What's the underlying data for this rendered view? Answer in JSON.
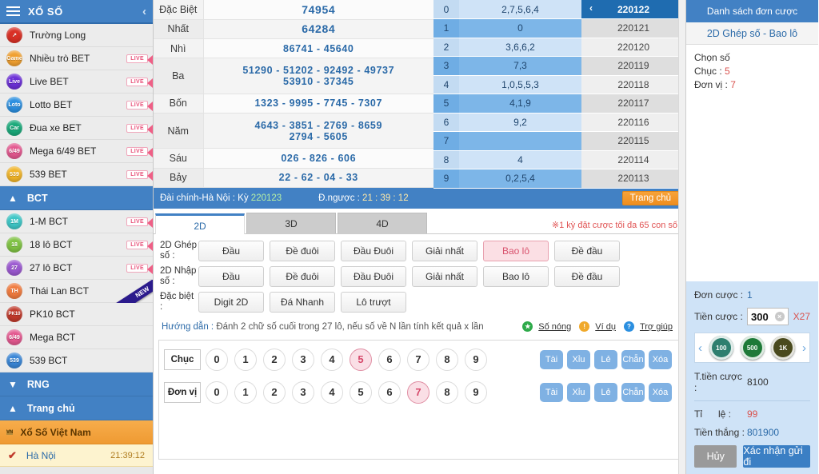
{
  "sidebar": {
    "header": {
      "title": "XỔ SỐ",
      "menu_icon": "hamburger-icon",
      "collapse_icon": "chevron-left-icon"
    },
    "items": [
      {
        "label": "Trường Long",
        "icon": "chart-icon",
        "icon_text": "",
        "color": "#d93025",
        "live": ""
      },
      {
        "label": "Nhiều trò BET",
        "icon": "game-icon",
        "icon_text": "Game",
        "color": "#f0a030",
        "live": "LIVE"
      },
      {
        "label": "Live BET",
        "icon": "live-icon",
        "icon_text": "Live",
        "color": "#6b2fd6",
        "live": "LIVE"
      },
      {
        "label": "Lotto BET",
        "icon": "lotto-icon",
        "icon_text": "Loto",
        "color": "#2b8fe0",
        "live": "LIVE"
      },
      {
        "label": "Đua xe BET",
        "icon": "car-icon",
        "icon_text": "Car",
        "color": "#1aa97a",
        "live": "LIVE"
      },
      {
        "label": "Mega 6/49 BET",
        "icon": "mega649-icon",
        "icon_text": "6/49",
        "color": "#e3588f",
        "live": "LIVE"
      },
      {
        "label": "539 BET",
        "icon": "539-icon",
        "icon_text": "539",
        "color": "#f0b429",
        "live": "LIVE"
      }
    ],
    "group_bct": {
      "label": "BCT",
      "arrow": "▲"
    },
    "bct_items": [
      {
        "label": "1-M BCT",
        "icon": "1m-bct-icon",
        "icon_text": "1M",
        "color": "#3ec6c6",
        "live": "LIVE",
        "new": ""
      },
      {
        "label": "18 lô BCT",
        "icon": "18-bct-icon",
        "icon_text": "18",
        "color": "#7fc243",
        "live": "LIVE",
        "new": ""
      },
      {
        "label": "27 lô BCT",
        "icon": "27-bct-icon",
        "icon_text": "27",
        "color": "#9b59d0",
        "live": "LIVE",
        "new": ""
      },
      {
        "label": "Thái Lan BCT",
        "icon": "th-bct-icon",
        "icon_text": "TH",
        "color": "#f07b3f",
        "live": "",
        "new": "NEW"
      },
      {
        "label": "PK10 BCT",
        "icon": "pk10-bct-icon",
        "icon_text": "PK10",
        "color": "#c0392b",
        "live": "",
        "new": ""
      },
      {
        "label": "Mega BCT",
        "icon": "mega-bct-icon",
        "icon_text": "6/49",
        "color": "#e3588f",
        "live": "",
        "new": ""
      },
      {
        "label": "539 BCT",
        "icon": "539-bct-icon",
        "icon_text": "539",
        "color": "#3a86d6",
        "live": "",
        "new": ""
      }
    ],
    "group_rng": {
      "label": "RNG",
      "arrow": "▼"
    },
    "group_home": {
      "label": "Trang chủ",
      "arrow": "▲"
    },
    "active_item": {
      "label": "Xổ Số Việt Nam",
      "icon": "vn-lottery-icon",
      "icon_text": "VN",
      "color": "#b58a3a"
    },
    "selected_item": {
      "label": "Hà Nội",
      "time": "21:39:12",
      "check": "✔"
    }
  },
  "results": {
    "rows": [
      {
        "name": "Đặc Biệt",
        "values": "74954"
      },
      {
        "name": "Nhất",
        "values": "64284"
      },
      {
        "name": "Nhì",
        "values": "86741 - 45640"
      },
      {
        "name": "Ba",
        "values": "51290 - 51202 - 92492 - 49737\n53910 - 37345"
      },
      {
        "name": "Bốn",
        "values": "1323 - 9995 - 7745 - 7307"
      },
      {
        "name": "Năm",
        "values": "4643 - 3851 - 2769 - 8659\n2794 - 5605"
      },
      {
        "name": "Sáu",
        "values": "026 - 826 - 606"
      },
      {
        "name": "Bảy",
        "values": "22 - 62 - 04 - 33"
      }
    ],
    "digit_rows": [
      {
        "digit": "0",
        "tails": "2,7,5,6,4"
      },
      {
        "digit": "1",
        "tails": "0"
      },
      {
        "digit": "2",
        "tails": "3,6,6,2"
      },
      {
        "digit": "3",
        "tails": "7,3"
      },
      {
        "digit": "4",
        "tails": "1,0,5,5,3"
      },
      {
        "digit": "5",
        "tails": "4,1,9"
      },
      {
        "digit": "6",
        "tails": "9,2"
      },
      {
        "digit": "7",
        "tails": ""
      },
      {
        "digit": "8",
        "tails": "4"
      },
      {
        "digit": "9",
        "tails": "0,2,5,4"
      }
    ],
    "periods": [
      {
        "id": "220122",
        "selected": true,
        "prev_icon": "chevron-left-icon"
      },
      {
        "id": "220121",
        "selected": false
      },
      {
        "id": "220120",
        "selected": false
      },
      {
        "id": "220119",
        "selected": false
      },
      {
        "id": "220118",
        "selected": false
      },
      {
        "id": "220117",
        "selected": false
      },
      {
        "id": "220116",
        "selected": false
      },
      {
        "id": "220115",
        "selected": false
      },
      {
        "id": "220114",
        "selected": false
      },
      {
        "id": "220113",
        "selected": false
      }
    ]
  },
  "infobar": {
    "station_label": "Đài chính-Hà Nội :",
    "period_label": "Kỳ",
    "period_value": "220123",
    "countdown_label": "Đ.ngược :",
    "countdown_value": "21 : 39 : 12",
    "home_button": "Trang chủ"
  },
  "tabs": [
    {
      "label": "2D",
      "active": true
    },
    {
      "label": "3D",
      "active": false
    },
    {
      "label": "4D",
      "active": false
    }
  ],
  "tabs_note": "※1 kỳ đặt cược tối đa 65 con số",
  "bet_types": [
    {
      "label": "2D Ghép số :",
      "buttons": [
        {
          "text": "Đầu",
          "selected": false
        },
        {
          "text": "Đề đuôi",
          "selected": false
        },
        {
          "text": "Đầu Đuôi",
          "selected": false
        },
        {
          "text": "Giải nhất",
          "selected": false
        },
        {
          "text": "Bao lô",
          "selected": true
        },
        {
          "text": "Đề đầu",
          "selected": false
        }
      ]
    },
    {
      "label": "2D Nhập số :",
      "buttons": [
        {
          "text": "Đầu",
          "selected": false
        },
        {
          "text": "Đề đuôi",
          "selected": false
        },
        {
          "text": "Đầu Đuôi",
          "selected": false
        },
        {
          "text": "Giải nhất",
          "selected": false
        },
        {
          "text": "Bao lô",
          "selected": false
        },
        {
          "text": "Đề đầu",
          "selected": false
        }
      ]
    },
    {
      "label": "Đặc biệt :",
      "buttons": [
        {
          "text": "Digit 2D",
          "selected": false
        },
        {
          "text": "Đá Nhanh",
          "selected": false
        },
        {
          "text": "Lô trượt",
          "selected": false
        }
      ]
    }
  ],
  "hint": {
    "label": "Hướng dẫn :",
    "text": "Đánh 2 chữ số cuối trong 27 lô, nếu số về N lần tính kết quả x lần",
    "links": [
      {
        "text": "Số nóng",
        "icon": "star-icon",
        "color": "#2eaa4a"
      },
      {
        "text": "Ví dụ",
        "icon": "bulb-icon",
        "color": "#f0a92b"
      },
      {
        "text": "Trợ giúp",
        "icon": "question-icon",
        "color": "#2b8fe0"
      }
    ]
  },
  "picker": {
    "rows": [
      {
        "name": "Chục",
        "digits": [
          "0",
          "1",
          "2",
          "3",
          "4",
          "5",
          "6",
          "7",
          "8",
          "9"
        ],
        "selected": [
          "5"
        ]
      },
      {
        "name": "Đơn vị",
        "digits": [
          "0",
          "1",
          "2",
          "3",
          "4",
          "5",
          "6",
          "7",
          "8",
          "9"
        ],
        "selected": [
          "7"
        ]
      }
    ],
    "ops": [
      "Tài",
      "Xỉu",
      "Lẻ",
      "Chẵn",
      "Xóa"
    ]
  },
  "right_panel": {
    "header": "Danh sách đơn cược",
    "subheader": "2D Ghép số - Bao lô",
    "choose_label": "Chọn số",
    "tens_label": "Chục :",
    "tens_value": "5",
    "units_label": "Đơn vị :",
    "units_value": "7",
    "bet_count_label": "Đơn cược :",
    "bet_count_value": "1",
    "stake_label": "Tiền cược :",
    "stake_value": "300",
    "stake_clear_icon": "clear-icon",
    "multiplier": "X27",
    "chips_prev_icon": "chevron-left-icon",
    "chips_next_icon": "chevron-right-icon",
    "chips": [
      {
        "label": "100",
        "color": "#2e7f6f"
      },
      {
        "label": "500",
        "color": "#1e7a38"
      },
      {
        "label": "1K",
        "color": "#4a4a1e"
      }
    ],
    "total_label": "T.tiền cược :",
    "total_value": "8100",
    "rate_label": "Tỉ      lệ :",
    "rate_value": "99",
    "win_label": "Tiền thắng :",
    "win_value": "801900",
    "cancel_button": "Hủy",
    "confirm_button": "Xác nhận gửi đi"
  }
}
